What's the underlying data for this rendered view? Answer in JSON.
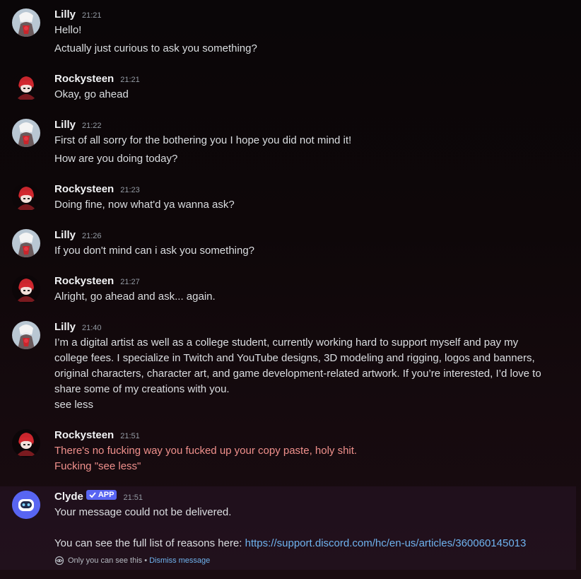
{
  "messages": [
    {
      "author": "Lilly",
      "time": "21:21",
      "avatar": "lilly-avatar-icon",
      "lines": [
        "Hello!",
        "Actually just curious to ask you something?"
      ]
    },
    {
      "author": "Rockysteen",
      "time": "21:21",
      "avatar": "rockysteen-avatar-icon",
      "lines": [
        "Okay, go ahead"
      ]
    },
    {
      "author": "Lilly",
      "time": "21:22",
      "avatar": "lilly-avatar-icon",
      "lines": [
        "First of all sorry for the bothering you I hope you did not mind it!",
        "How are you doing today?"
      ]
    },
    {
      "author": "Rockysteen",
      "time": "21:23",
      "avatar": "rockysteen-avatar-icon",
      "lines": [
        "Doing fine, now what'd ya wanna ask?"
      ]
    },
    {
      "author": "Lilly",
      "time": "21:26",
      "avatar": "lilly-avatar-icon",
      "lines": [
        "If you don't mind can i ask you something?"
      ]
    },
    {
      "author": "Rockysteen",
      "time": "21:27",
      "avatar": "rockysteen-avatar-icon",
      "lines": [
        "Alright, go ahead and ask... again."
      ]
    },
    {
      "author": "Lilly",
      "time": "21:40",
      "avatar": "lilly-avatar-icon",
      "lines": [
        "I’m a digital artist as well as a college student, currently working hard to support myself and pay my college fees. I specialize in Twitch and YouTube designs, 3D modeling and rigging, logos and banners, original characters, character art, and game development-related artwork. If you’re interested, I’d love to share some of my creations with you.",
        "see less"
      ]
    },
    {
      "author": "Rockysteen",
      "time": "21:51",
      "avatar": "rockysteen-avatar-icon",
      "lines": [
        "There's no fucking way you fucked up your copy paste, holy shit.",
        "Fucking \"see less\""
      ]
    }
  ],
  "clyde": {
    "author": "Clyde",
    "badge": "APP",
    "time": "21:51",
    "avatar": "clyde-bot-avatar-icon",
    "line1": "Your message could not be delivered.",
    "line2_prefix": "You can see the full list of reasons here: ",
    "link": "https://support.discord.com/hc/en-us/articles/360060145013",
    "ephemeral_note": "Only you can see this •",
    "dismiss": "Dismiss message"
  },
  "colors": {
    "link": "#6fb3ef",
    "red_text": "#f0908c",
    "badge": "#5865f2"
  }
}
